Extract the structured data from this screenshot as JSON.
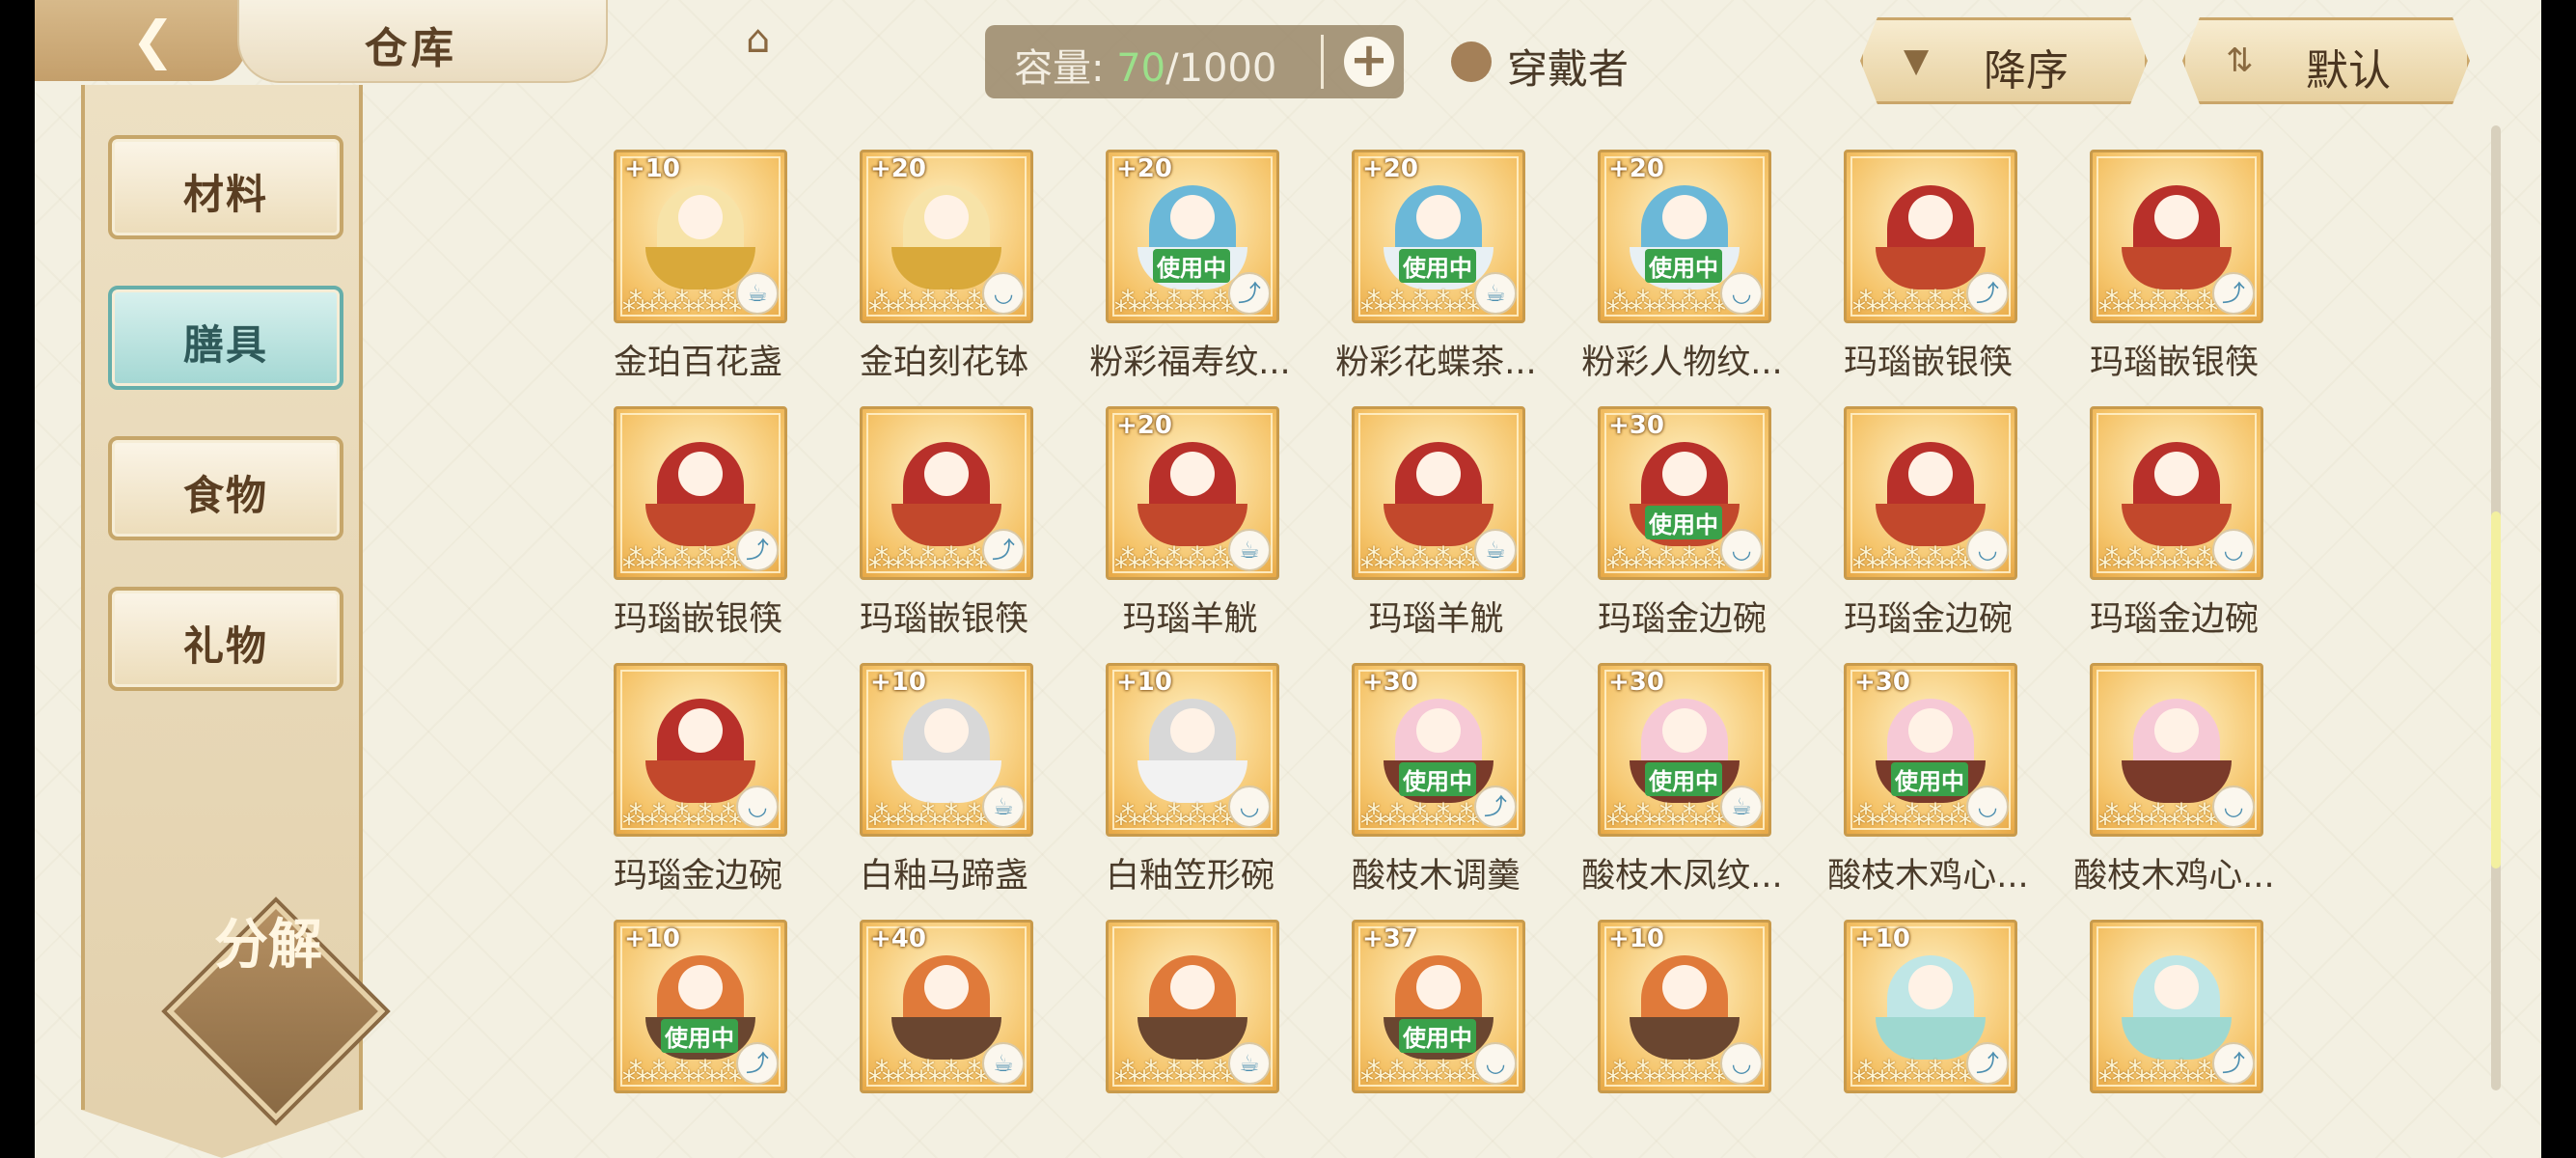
{
  "header": {
    "title": "仓库",
    "back_icon": "back-arrow-icon",
    "house_icon": "pavilion-icon",
    "capacity_label": "容量:",
    "capacity_used": "70",
    "capacity_total": "/1000",
    "capacity_plus": "+",
    "wearer_label": "穿戴者",
    "sort_desc_label": "降序",
    "sort_default_label": "默认"
  },
  "sidebar": {
    "items": [
      {
        "label": "材料",
        "active": false
      },
      {
        "label": "膳具",
        "active": true
      },
      {
        "label": "食物",
        "active": false
      },
      {
        "label": "礼物",
        "active": false
      }
    ],
    "decompose_label": "分解"
  },
  "colors": {
    "accent_green": "#9be08a",
    "active_tab": "#a3d7d3",
    "frame_gold": "#f5c46a",
    "in_use_green": "#3aa14a"
  },
  "items": [
    {
      "name": "金珀百花盏",
      "level": "+10",
      "in_use": false,
      "badge": "teapot",
      "theme": "gold"
    },
    {
      "name": "金珀刻花钵",
      "level": "+20",
      "in_use": false,
      "badge": "bowl",
      "theme": "gold"
    },
    {
      "name": "粉彩福寿纹...",
      "level": "+20",
      "in_use": true,
      "badge": "spoon",
      "theme": "porcelain"
    },
    {
      "name": "粉彩花蝶茶...",
      "level": "+20",
      "in_use": true,
      "badge": "teapot",
      "theme": "porcelain"
    },
    {
      "name": "粉彩人物纹...",
      "level": "+20",
      "in_use": true,
      "badge": "bowl",
      "theme": "porcelain"
    },
    {
      "name": "玛瑙嵌银筷",
      "level": "",
      "in_use": false,
      "badge": "spoon",
      "theme": "agate"
    },
    {
      "name": "玛瑙嵌银筷",
      "level": "",
      "in_use": false,
      "badge": "spoon",
      "theme": "agate"
    },
    {
      "name": "玛瑙嵌银筷",
      "level": "",
      "in_use": false,
      "badge": "spoon",
      "theme": "agate"
    },
    {
      "name": "玛瑙嵌银筷",
      "level": "",
      "in_use": false,
      "badge": "spoon",
      "theme": "agate"
    },
    {
      "name": "玛瑙羊觥",
      "level": "+20",
      "in_use": false,
      "badge": "teapot",
      "theme": "agate"
    },
    {
      "name": "玛瑙羊觥",
      "level": "",
      "in_use": false,
      "badge": "teapot",
      "theme": "agate"
    },
    {
      "name": "玛瑙金边碗",
      "level": "+30",
      "in_use": true,
      "badge": "bowl",
      "theme": "agate"
    },
    {
      "name": "玛瑙金边碗",
      "level": "",
      "in_use": false,
      "badge": "bowl",
      "theme": "agate"
    },
    {
      "name": "玛瑙金边碗",
      "level": "",
      "in_use": false,
      "badge": "bowl",
      "theme": "agate"
    },
    {
      "name": "玛瑙金边碗",
      "level": "",
      "in_use": false,
      "badge": "bowl",
      "theme": "agate"
    },
    {
      "name": "白釉马蹄盏",
      "level": "+10",
      "in_use": false,
      "badge": "teapot",
      "theme": "white"
    },
    {
      "name": "白釉笠形碗",
      "level": "+10",
      "in_use": false,
      "badge": "bowl",
      "theme": "white"
    },
    {
      "name": "酸枝木调羹",
      "level": "+30",
      "in_use": true,
      "badge": "spoon",
      "theme": "wood"
    },
    {
      "name": "酸枝木凤纹...",
      "level": "+30",
      "in_use": true,
      "badge": "teapot",
      "theme": "wood"
    },
    {
      "name": "酸枝木鸡心...",
      "level": "+30",
      "in_use": true,
      "badge": "bowl",
      "theme": "wood"
    },
    {
      "name": "酸枝木鸡心...",
      "level": "",
      "in_use": false,
      "badge": "bowl",
      "theme": "wood"
    },
    {
      "name": "",
      "level": "+10",
      "in_use": true,
      "badge": "spoon",
      "theme": "orange"
    },
    {
      "name": "",
      "level": "+40",
      "in_use": false,
      "badge": "teapot",
      "theme": "orange"
    },
    {
      "name": "",
      "level": "",
      "in_use": false,
      "badge": "teapot",
      "theme": "orange"
    },
    {
      "name": "",
      "level": "+37",
      "in_use": true,
      "badge": "bowl",
      "theme": "orange"
    },
    {
      "name": "",
      "level": "+10",
      "in_use": false,
      "badge": "bowl",
      "theme": "orange"
    },
    {
      "name": "",
      "level": "+10",
      "in_use": false,
      "badge": "spoon",
      "theme": "jade"
    },
    {
      "name": "",
      "level": "",
      "in_use": false,
      "badge": "spoon",
      "theme": "jade"
    }
  ],
  "in_use_label": "使用中",
  "stars": "⁂⁂⁂⁂⁂"
}
